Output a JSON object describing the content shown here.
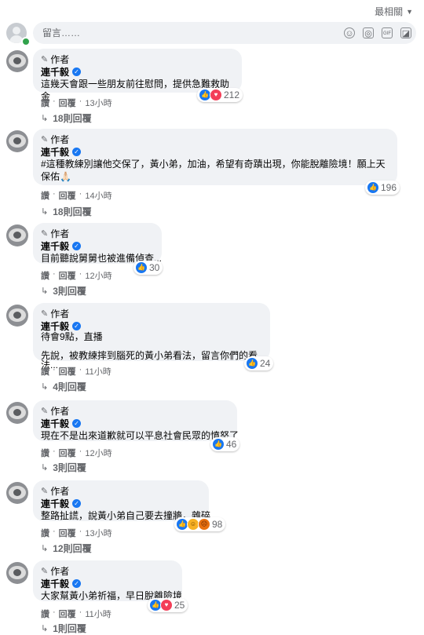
{
  "sort": {
    "label": "最相關",
    "icon": "caret-down-icon"
  },
  "composer": {
    "placeholder": "留言……"
  },
  "comments": [
    {
      "author_badge": "作者",
      "author": "連千毅",
      "text": "這幾天會跟一些朋友前往慰問，提供急難救助金",
      "reaction_count": "212",
      "like": "讚",
      "reply": "回覆",
      "time": "13小時",
      "replies": "18則回覆"
    },
    {
      "author_badge": "作者",
      "author": "連千毅",
      "text": "#這種教練別讓他交保了，黃小弟，加油，希望有奇蹟出現，你能脫離險境！願上天保佑🙏🏻",
      "reaction_count": "196",
      "like": "讚",
      "reply": "回覆",
      "time": "14小時",
      "replies": "18則回覆"
    },
    {
      "author_badge": "作者",
      "author": "連千毅",
      "text": "目前聽說舅舅也被進備偵查...",
      "reaction_count": "30",
      "like": "讚",
      "reply": "回覆",
      "time": "12小時",
      "replies": "3則回覆"
    },
    {
      "author_badge": "作者",
      "author": "連千毅",
      "text": "待會9點，直播\n\n先說，被教練摔到腦死的黃小弟看法，留言你們的看法...",
      "reaction_count": "24",
      "like": "讚",
      "reply": "回覆",
      "time": "11小時",
      "replies": "4則回覆"
    },
    {
      "author_badge": "作者",
      "author": "連千毅",
      "text": "現在不是出來道歉就可以平息社會民眾的憤怒了",
      "reaction_count": "46",
      "like": "讚",
      "reply": "回覆",
      "time": "12小時",
      "replies": "3則回覆"
    },
    {
      "author_badge": "作者",
      "author": "連千毅",
      "text": "整路扯謊，說黃小弟自己要去撞牆，雜碎",
      "reaction_count": "98",
      "like": "讚",
      "reply": "回覆",
      "time": "13小時",
      "replies": "12則回覆"
    },
    {
      "author_badge": "作者",
      "author": "連千毅",
      "text": "大家幫黃小弟祈福，早日脫離險境",
      "reaction_count": "25",
      "like": "讚",
      "reply": "回覆",
      "time": "11小時",
      "replies": "1則回覆"
    }
  ]
}
